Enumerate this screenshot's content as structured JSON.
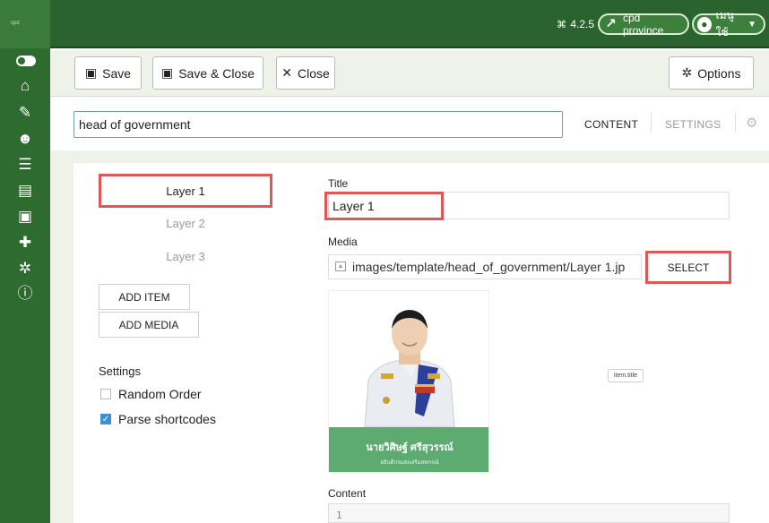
{
  "topbar": {
    "logo_text": "cpd",
    "version": "4.2.5",
    "site_label": "cpd province",
    "user_label": "เมนูใช้"
  },
  "sidebar": {
    "icons": [
      "toggle-icon",
      "home-icon",
      "wrench-icon",
      "users-icon",
      "list-icon",
      "file-icon",
      "image-icon",
      "puzzle-icon",
      "cogs-icon",
      "info-icon"
    ]
  },
  "toolbar": {
    "save_label": "Save",
    "save_close_label": "Save & Close",
    "close_label": "Close",
    "options_label": "Options"
  },
  "titlebar": {
    "title_value": "head of government",
    "tab_content": "CONTENT",
    "tab_settings": "SETTINGS"
  },
  "layers": {
    "items": [
      {
        "label": "Layer 1"
      },
      {
        "label": "Layer 2"
      },
      {
        "label": "Layer 3"
      }
    ],
    "add_item_label": "ADD ITEM",
    "add_media_label": "ADD MEDIA"
  },
  "settings": {
    "heading": "Settings",
    "random_order_label": "Random Order",
    "parse_shortcodes_label": "Parse shortcodes",
    "random_order_checked": false,
    "parse_shortcodes_checked": true
  },
  "form": {
    "title_label": "Title",
    "title_value": "Layer 1",
    "media_label": "Media",
    "media_value": "images/template/head_of_government/Layer 1.jp",
    "select_label": "SELECT",
    "content_label": "Content",
    "content_line": "1"
  },
  "preview": {
    "name_line1": "นายวิศิษฐ์ ศรีสุวรรณ์",
    "name_line2": "อธิบดีกรมส่งเสริมสหกรณ์",
    "item_tag": "item.title"
  },
  "colors": {
    "topbar": "#2b632f",
    "sidebar": "#2e6b2f",
    "highlight": "#e05757",
    "banner": "#5eab72"
  }
}
